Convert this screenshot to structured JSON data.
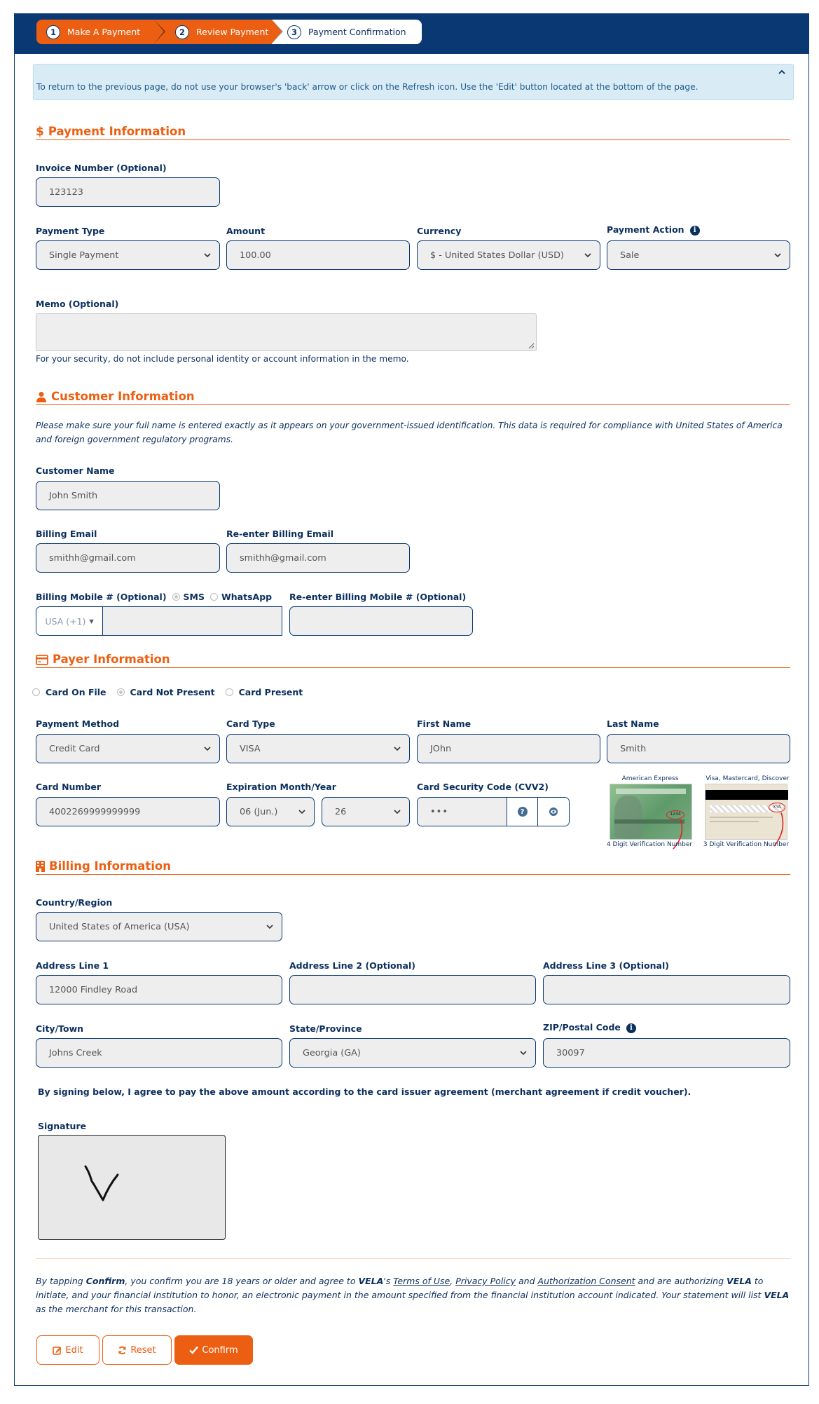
{
  "steps": [
    {
      "num": "1",
      "label": "Make A Payment",
      "state": "complete"
    },
    {
      "num": "2",
      "label": "Review Payment",
      "state": "current"
    },
    {
      "num": "3",
      "label": "Payment Confirmation",
      "state": "upcoming"
    }
  ],
  "alert": {
    "text": "To return to the previous page, do not use your browser's 'back' arrow or click on the Refresh icon. Use the 'Edit' button located at the bottom of the page.",
    "collapse_icon": "chevron-up-icon"
  },
  "colors": {
    "brand_orange": "#ec5f12",
    "brand_navy": "#0a3872",
    "field_bg": "#eeeeee",
    "alert_bg": "#d9ecf6"
  },
  "payment_info": {
    "heading": "Payment Information",
    "icon": "dollar-icon",
    "invoice": {
      "label": "Invoice Number (Optional)",
      "value": "123123"
    },
    "payment_type": {
      "label": "Payment Type",
      "value": "Single Payment"
    },
    "amount": {
      "label": "Amount",
      "value": "100.00"
    },
    "currency": {
      "label": "Currency",
      "value": "$ - United States Dollar (USD)"
    },
    "payment_action": {
      "label": "Payment Action",
      "value": "Sale",
      "info_icon": "info-icon"
    },
    "memo": {
      "label": "Memo (Optional)",
      "value": "",
      "help": "For your security, do not include personal identity or account information in the memo."
    }
  },
  "customer_info": {
    "heading": "Customer Information",
    "icon": "user-icon",
    "notice": "Please make sure your full name is entered exactly as it appears on your government-issued identification. This data is required for compliance with United States of America and foreign government regulatory programs.",
    "customer_name": {
      "label": "Customer Name",
      "value": "John Smith"
    },
    "billing_email": {
      "label": "Billing Email",
      "value": "smithh@gmail.com"
    },
    "reenter_email": {
      "label": "Re-enter Billing Email",
      "value": "smithh@gmail.com"
    },
    "mobile": {
      "label": "Billing Mobile # (Optional)",
      "sms_label": "SMS",
      "whatsapp_label": "WhatsApp",
      "country_code": "USA (+1)",
      "value": ""
    },
    "reenter_mobile": {
      "label": "Re-enter Billing Mobile # (Optional)",
      "value": ""
    }
  },
  "payer_info": {
    "heading": "Payer Information",
    "icon": "credit-card-icon",
    "card_modes": [
      {
        "label": "Card On File",
        "selected": false
      },
      {
        "label": "Card Not Present",
        "selected": true
      },
      {
        "label": "Card Present",
        "selected": false
      }
    ],
    "payment_method": {
      "label": "Payment Method",
      "value": "Credit Card"
    },
    "card_type": {
      "label": "Card Type",
      "value": "VISA"
    },
    "first_name": {
      "label": "First Name",
      "value": "JOhn"
    },
    "last_name": {
      "label": "Last Name",
      "value": "Smith"
    },
    "card_number": {
      "label": "Card Number",
      "value": "4002269999999999"
    },
    "expiration": {
      "label": "Expiration Month/Year",
      "month": "06 (Jun.)",
      "year": "26"
    },
    "cvv": {
      "label": "Card Security Code (CVV2)",
      "value": "•••"
    },
    "card_images": [
      {
        "title": "American Express",
        "caption": "4 Digit Verification Number",
        "sample_code": "1234"
      },
      {
        "title": "Visa, Mastercard, Discover",
        "caption": "3 Digit Verification Number",
        "sample_code": "XYA"
      }
    ]
  },
  "billing_info": {
    "heading": "Billing Information",
    "icon": "building-icon",
    "country": {
      "label": "Country/Region",
      "value": "United States of America (USA)"
    },
    "address1": {
      "label": "Address Line 1",
      "value": "12000 Findley Road"
    },
    "address2": {
      "label": "Address Line 2 (Optional)",
      "value": ""
    },
    "address3": {
      "label": "Address Line 3 (Optional)",
      "value": ""
    },
    "city": {
      "label": "City/Town",
      "value": "Johns Creek"
    },
    "state": {
      "label": "State/Province",
      "value": "Georgia (GA)"
    },
    "zip": {
      "label": "ZIP/Postal Code",
      "value": "30097"
    },
    "agreement": "By signing below, I agree to pay the above amount according to the card issuer agreement (merchant agreement if credit voucher).",
    "signature_label": "Signature"
  },
  "legal": {
    "p1": "By tapping ",
    "confirm_word": "Confirm",
    "p2": ", you confirm you are 18 years or older and agree to ",
    "merchant": "VELA",
    "p3": "'s ",
    "terms": "Terms of Use",
    "sep": ", ",
    "privacy": "Privacy Policy",
    "and": " and ",
    "consent": "Authorization Consent",
    "p4": " and are authorizing ",
    "p5": " to initiate, and your financial institution to honor, an electronic payment in the amount specified from the financial institution account indicated. Your statement will list ",
    "p6": " as the merchant for this transaction."
  },
  "buttons": {
    "edit": "Edit",
    "reset": "Reset",
    "confirm": "Confirm"
  }
}
